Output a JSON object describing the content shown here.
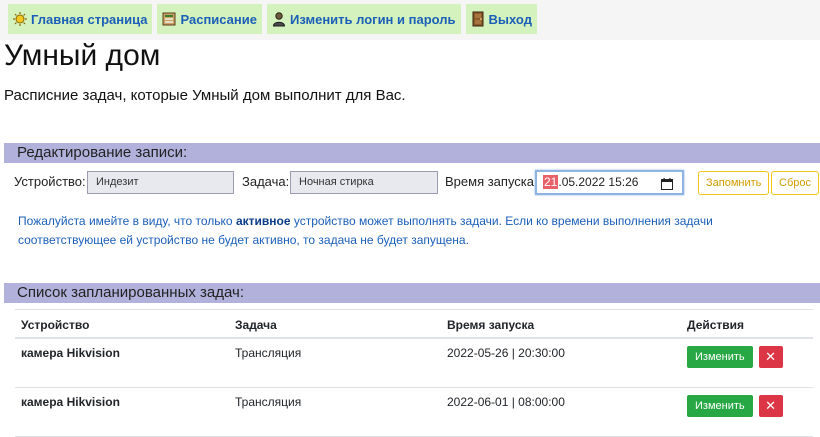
{
  "nav": [
    {
      "label": "Главная страница",
      "icon": "sun-icon"
    },
    {
      "label": "Расписание",
      "icon": "schedule-icon"
    },
    {
      "label": "Изменить логин и пароль",
      "icon": "user-icon"
    },
    {
      "label": "Выход",
      "icon": "door-icon"
    }
  ],
  "page": {
    "title": "Умный дом",
    "subtitle": "Расписние задач, которые Умный дом выполнит для Вас."
  },
  "edit": {
    "section_title": "Редактирование записи:",
    "device_label": "Устройство:",
    "device_value": "Индезит",
    "task_label": "Задача:",
    "task_value": "Ночная стирка",
    "time_label": "Время запуска:",
    "time_selected": "21",
    "time_rest": ".05.2022 15:26",
    "save_label": "Запомнить",
    "reset_label": "Сброс"
  },
  "note": {
    "part1": "Пожалуйста имейте в виду, что только ",
    "bold": "активное",
    "part2": " устройство может выполнять задачи. Если ко времени выполнения задачи соответствующее ей устройство не будет активно, то задача не будет запущена."
  },
  "list": {
    "section_title": "Список запланированных задач:",
    "headers": {
      "device": "Устройство",
      "task": "Задача",
      "time": "Время запуска",
      "actions": "Действия"
    },
    "rows": [
      {
        "device": "камера Hikvision",
        "task": "Трансляция",
        "time": "2022-05-26 | 20:30:00",
        "edit_label": "Изменить",
        "delete_label": "✕"
      },
      {
        "device": "камера Hikvision",
        "task": "Трансляция",
        "time": "2022-06-01 | 08:00:00",
        "edit_label": "Изменить",
        "delete_label": "✕"
      }
    ]
  },
  "colors": {
    "nav_bg": "#d4f2bd",
    "link": "#1b5fb8",
    "section_bg": "#b1b1dc",
    "edit_button": "#28a745",
    "delete_button": "#dc3545",
    "outline_button": "#f0c419"
  }
}
